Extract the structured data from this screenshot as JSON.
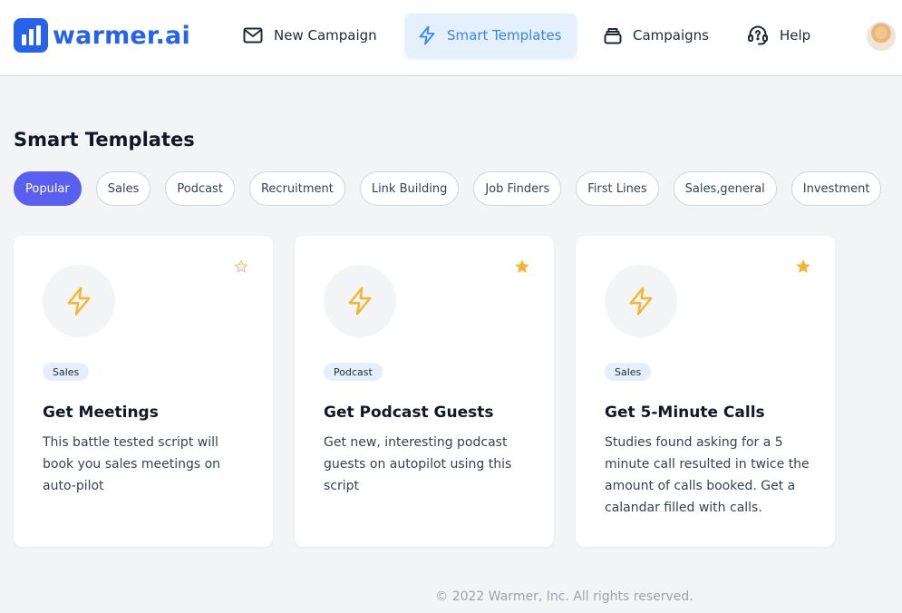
{
  "brand": {
    "name": "warmer.ai",
    "color": "#2563eb"
  },
  "nav": {
    "items": [
      {
        "label": "New Campaign",
        "icon": "mail-icon"
      },
      {
        "label": "Smart Templates",
        "icon": "lightning-icon",
        "active": true
      },
      {
        "label": "Campaigns",
        "icon": "stack-icon"
      },
      {
        "label": "Help",
        "icon": "headset-icon"
      }
    ]
  },
  "page": {
    "title": "Smart Templates"
  },
  "filters": [
    {
      "label": "Popular",
      "active": true
    },
    {
      "label": "Sales"
    },
    {
      "label": "Podcast"
    },
    {
      "label": "Recruitment"
    },
    {
      "label": "Link Building"
    },
    {
      "label": "Job Finders"
    },
    {
      "label": "First Lines"
    },
    {
      "label": "Sales,general"
    },
    {
      "label": "Investment"
    }
  ],
  "cards": [
    {
      "tag": "Sales",
      "title": "Get Meetings",
      "description": "This battle tested script will book you sales meetings on auto-pilot",
      "starred": false
    },
    {
      "tag": "Podcast",
      "title": "Get Podcast Guests",
      "description": "Get new, interesting podcast guests on autopilot using this script",
      "starred": true
    },
    {
      "tag": "Sales",
      "title": "Get 5-Minute Calls",
      "description": "Studies found asking for a 5 minute call resulted in twice the amount of calls booked. Get a calandar filled with calls.",
      "starred": true
    }
  ],
  "footer": {
    "text": "© 2022 Warmer, Inc. All rights reserved."
  },
  "colors": {
    "accent": "#5b5ff0",
    "nav_active_bg": "#e5f0fd",
    "nav_active_text": "#3b82f6",
    "lightning": "#f5b52e",
    "star": "#f5b52e"
  }
}
